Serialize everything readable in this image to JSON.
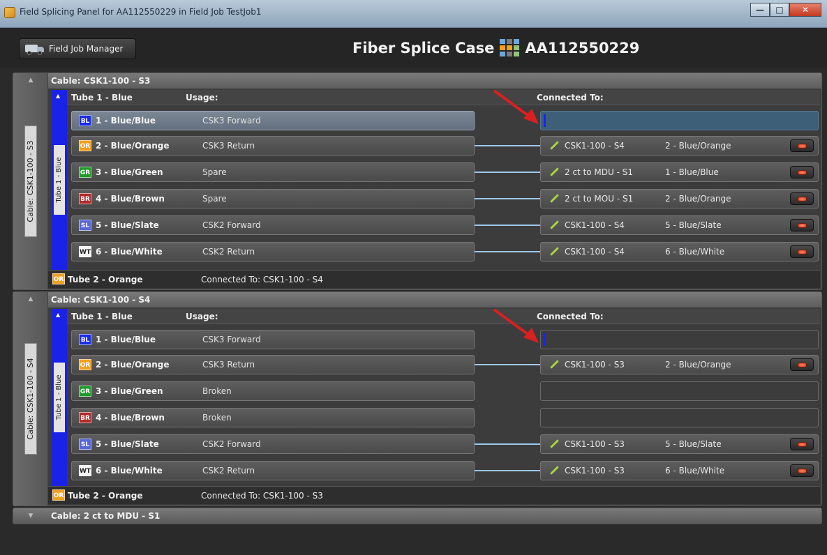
{
  "window": {
    "title": "Field Splicing Panel for AA112550229 in Field Job TestJob1",
    "min_label": "—",
    "max_label": "□",
    "close_label": "✕"
  },
  "header": {
    "field_job_manager_label": "Field Job Manager",
    "case_title_prefix": "Fiber Splice Case",
    "case_id": "AA112550229"
  },
  "labels": {
    "usage": "Usage:",
    "connected_to": "Connected To:"
  },
  "colors": {
    "blue": "#1a2be0",
    "orange": "#f2a01e",
    "green": "#1f9a2a",
    "brown": "#b02a2a",
    "slate": "#5866d8",
    "white": "#f4f4f4",
    "tube_strip": "#1a22e6",
    "link_line": "#9ec8ea",
    "remove_button": "#d2381a"
  },
  "cables": [
    {
      "header": "Cable: CSK1-100 - S3",
      "vertical_label": "Cable: CSK1-100 - S3",
      "tube1": {
        "name": "Tube 1 - Blue",
        "vertical_label": "Tube 1 - Blue",
        "fibers": [
          {
            "tag": "BL",
            "name": "1 - Blue/Blue",
            "usage": "CSK3 Forward",
            "conn_cable": "",
            "conn_fiber": ""
          },
          {
            "tag": "OR",
            "name": "2 - Blue/Orange",
            "usage": "CSK3 Return",
            "conn_cable": "CSK1-100 - S4",
            "conn_fiber": "2 - Blue/Orange"
          },
          {
            "tag": "GR",
            "name": "3 - Blue/Green",
            "usage": "Spare",
            "conn_cable": "2 ct to MDU - S1",
            "conn_fiber": "1 - Blue/Blue"
          },
          {
            "tag": "BR",
            "name": "4 - Blue/Brown",
            "usage": "Spare",
            "conn_cable": "2 ct to MOU - S1",
            "conn_fiber": "2 - Blue/Orange"
          },
          {
            "tag": "SL",
            "name": "5 - Blue/Slate",
            "usage": "CSK2 Forward",
            "conn_cable": "CSK1-100 - S4",
            "conn_fiber": "5 - Blue/Slate"
          },
          {
            "tag": "WT",
            "name": "6 - Blue/White",
            "usage": "CSK2 Return",
            "conn_cable": "CSK1-100 - S4",
            "conn_fiber": "6 - Blue/White"
          }
        ]
      },
      "tube2": {
        "tag": "OR",
        "name": "Tube 2 - Orange",
        "connected": "Connected To: CSK1-100 - S4"
      }
    },
    {
      "header": "Cable: CSK1-100 - S4",
      "vertical_label": "Cable: CSK1-100 - S4",
      "tube1": {
        "name": "Tube 1 - Blue",
        "vertical_label": "Tube 1 - Blue",
        "fibers": [
          {
            "tag": "BL",
            "name": "1 - Blue/Blue",
            "usage": "CSK3 Forward",
            "conn_cable": "",
            "conn_fiber": ""
          },
          {
            "tag": "OR",
            "name": "2 - Blue/Orange",
            "usage": "CSK3 Return",
            "conn_cable": "CSK1-100 - S3",
            "conn_fiber": "2 - Blue/Orange"
          },
          {
            "tag": "GR",
            "name": "3 - Blue/Green",
            "usage": "Broken",
            "conn_cable": "",
            "conn_fiber": ""
          },
          {
            "tag": "BR",
            "name": "4 - Blue/Brown",
            "usage": "Broken",
            "conn_cable": "",
            "conn_fiber": ""
          },
          {
            "tag": "SL",
            "name": "5 - Blue/Slate",
            "usage": "CSK2 Forward",
            "conn_cable": "CSK1-100 - S3",
            "conn_fiber": "5 - Blue/Slate"
          },
          {
            "tag": "WT",
            "name": "6 - Blue/White",
            "usage": "CSK2 Return",
            "conn_cable": "CSK1-100 - S3",
            "conn_fiber": "6 - Blue/White"
          }
        ]
      },
      "tube2": {
        "tag": "OR",
        "name": "Tube 2 - Orange",
        "connected": "Connected To: CSK1-100 - S3"
      }
    }
  ],
  "cable3": {
    "header": "Cable: 2 ct to MDU - S1"
  }
}
